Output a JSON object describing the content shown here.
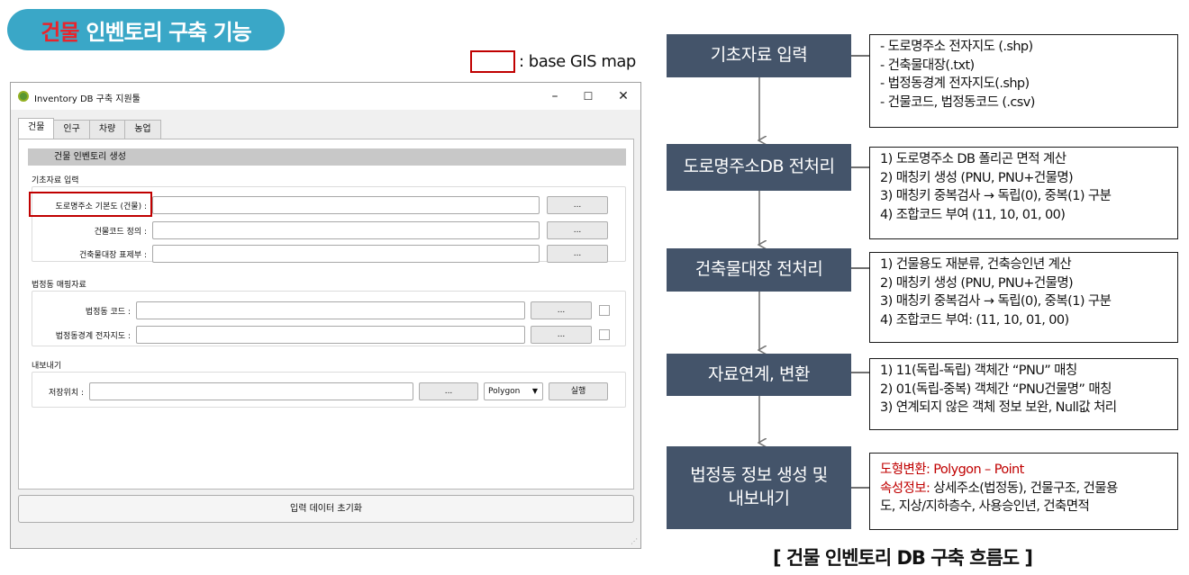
{
  "title": {
    "highlight": "건물",
    "rest": "인벤토리 구축 기능"
  },
  "legend": {
    "text": ": base GIS map"
  },
  "qgis_window": {
    "title": "Inventory DB 구축 지원툴",
    "controls": [
      "–",
      "☐",
      "✕"
    ],
    "tabs": [
      "건물",
      "인구",
      "차량",
      "농업"
    ],
    "section_header": "건물 인벤토리 생성",
    "group1": {
      "label": "기초자료 입력",
      "rows": [
        {
          "label": "도로명주소 기본도 (건물) :",
          "value": "",
          "button": "..."
        },
        {
          "label": "건물코드 정의 :",
          "value": "",
          "button": "..."
        },
        {
          "label": "건축물대장 표제부 :",
          "value": "",
          "button": "..."
        }
      ]
    },
    "group2": {
      "label": "법정동 매핑자료",
      "rows": [
        {
          "label": "법정동 코드 :",
          "value": "",
          "button": "..."
        },
        {
          "label": "법정동경계 전자지도 :",
          "value": "",
          "button": "..."
        }
      ]
    },
    "group3": {
      "label": "내보내기",
      "save_label": "저장위치 :",
      "save_value": "",
      "browse_button": "...",
      "geometry_select": "Polygon",
      "run_button": "실행"
    },
    "reset_button": "입력 데이터 초기화"
  },
  "flow": {
    "steps": [
      "기초자료 입력",
      "도로명주소DB 전처리",
      "건축물대장 전처리",
      "자료연계, 변환",
      "법정동 정보 생성 및 내보내기"
    ],
    "descriptions": [
      [
        "- 도로명주소 전자지도 (.shp)",
        "- 건축물대장(.txt)",
        "- 법정동경계 전자지도(.shp)",
        "- 건물코드, 법정동코드 (.csv)"
      ],
      [
        "1) 도로명주소 DB 폴리곤 면적 계산",
        "2) 매칭키 생성 (PNU, PNU+건물명)",
        "3) 매칭키 중복검사 → 독립(0), 중복(1) 구분",
        "4) 조합코드 부여 (11, 10, 01, 00)"
      ],
      [
        "1) 건물용도 재분류, 건축승인년 계산",
        "2) 매칭키 생성 (PNU, PNU+건물명)",
        "3) 매칭키 중복검사 → 독립(0), 중복(1) 구분",
        "4) 조합코드 부여: (11, 10, 01, 00)"
      ],
      [
        "1) 11(독립-독립) 객체간 “PNU” 매칭",
        "2) 01(독립-중복) 객체간 “PNU건물명” 매칭",
        "3) 연계되지 않은 객체 정보 보완, Null값 처리"
      ]
    ],
    "last_desc": {
      "shape_label": "도형변환:",
      "shape_value": " Polygon – Point",
      "attr_label": "속성정보:",
      "attr_value": " 상세주소(법정동), 건물구조, 건물용",
      "attr_value2": "도, 지상/지하층수, 사용승인년, 건축면적"
    },
    "caption": "[ 건물 인벤토리 DB 구축 흐름도 ]"
  }
}
